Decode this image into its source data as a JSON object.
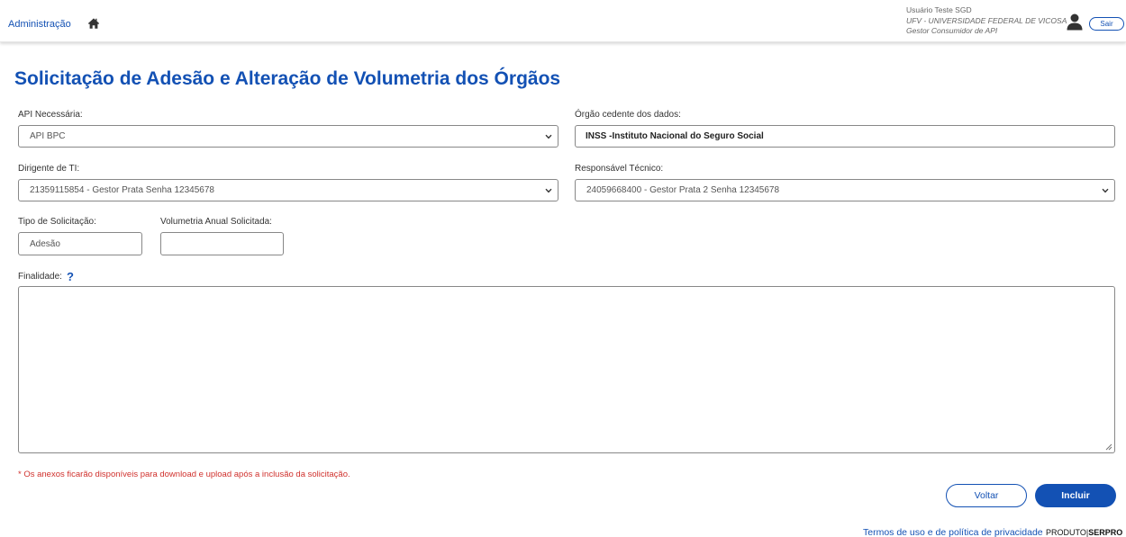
{
  "header": {
    "nav_admin": "Administração",
    "user_name": "Usuário Teste SGD",
    "user_org": "UFV - UNIVERSIDADE FEDERAL DE VICOSA",
    "user_role": "Gestor Consumidor de API",
    "logout_label": "Sair"
  },
  "page": {
    "title": "Solicitação de Adesão e Alteração de Volumetria dos Órgãos"
  },
  "form": {
    "api_label": "API Necessária:",
    "api_value": "API BPC",
    "orgao_label": "Órgão cedente dos dados:",
    "orgao_value": "INSS -Instituto Nacional do Seguro Social",
    "dirigente_label": "Dirigente de TI:",
    "dirigente_value": "21359115854 - Gestor Prata Senha 12345678",
    "responsavel_label": "Responsável Técnico:",
    "responsavel_value": "24059668400 - Gestor Prata 2 Senha 12345678",
    "tipo_label": "Tipo de Solicitação:",
    "tipo_value": "Adesão",
    "volumetria_label": "Volumetria Anual Solicitada:",
    "volumetria_value": "",
    "finalidade_label": "Finalidade:",
    "finalidade_help": "?",
    "finalidade_value": "",
    "note": "* Os anexos ficarão disponíveis para download e upload após a inclusão da solicitação."
  },
  "actions": {
    "back_label": "Voltar",
    "include_label": "Incluir"
  },
  "footer": {
    "terms": "Termos de uso e de política de privacidade",
    "product": "PRODUTO",
    "separator": "|",
    "brand": "SERPRO"
  },
  "colors": {
    "primary": "#1351b4",
    "note": "#d0312d"
  }
}
